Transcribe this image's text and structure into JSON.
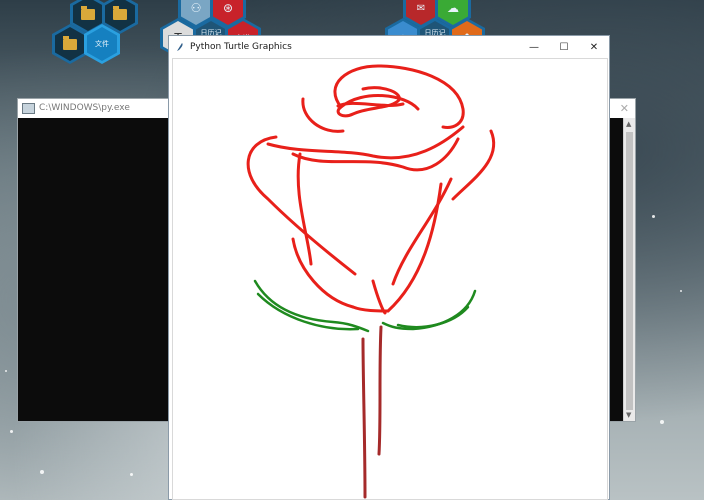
{
  "desktop": {
    "icons": [
      {
        "label": "",
        "kind": "folder"
      },
      {
        "label": "",
        "kind": "folder"
      },
      {
        "label": "",
        "kind": "folder"
      },
      {
        "label": "文件",
        "kind": "text"
      },
      {
        "label": "",
        "kind": "app"
      },
      {
        "label": "",
        "kind": "app"
      },
      {
        "label": "日历记001",
        "kind": "text"
      },
      {
        "label": "有道",
        "kind": "text"
      },
      {
        "label": "T",
        "kind": "text"
      },
      {
        "label": "",
        "kind": "app"
      },
      {
        "label": "",
        "kind": "app"
      },
      {
        "label": "日历记001",
        "kind": "text"
      }
    ]
  },
  "console_window": {
    "title": "C:\\WINDOWS\\py.exe",
    "close_glyph": "✕"
  },
  "turtle_window": {
    "title": "Python Turtle Graphics",
    "minimize_glyph": "—",
    "maximize_glyph": "☐",
    "close_glyph": "✕"
  },
  "drawing": {
    "subject": "rose",
    "petal_color": "#e8201a",
    "leaf_color": "#1f8a1f",
    "stem_color": "#a52a2a"
  }
}
